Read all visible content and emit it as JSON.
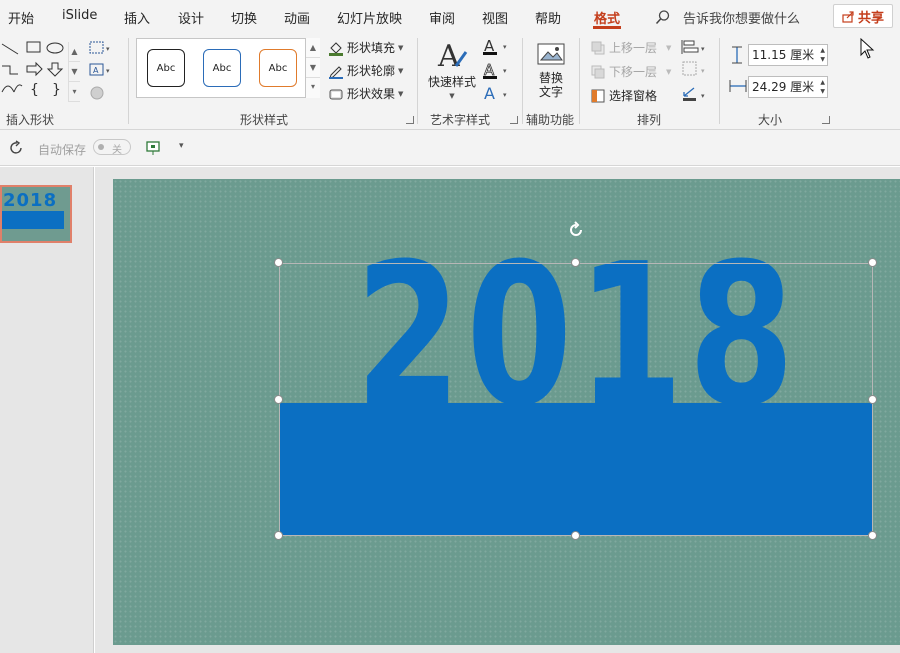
{
  "tabs": [
    "开始",
    "iSlide",
    "插入",
    "设计",
    "切换",
    "动画",
    "幻灯片放映",
    "审阅",
    "视图",
    "帮助",
    "格式"
  ],
  "active_tab": "格式",
  "search_hint": "告诉我你想要做什么",
  "share_label": "共享",
  "ribbon": {
    "insert_shapes_label": "插入形状",
    "shape_styles": {
      "gallery": [
        "Abc",
        "Abc",
        "Abc"
      ],
      "fill": "形状填充",
      "outline": "形状轮廓",
      "effects": "形状效果",
      "label": "形状样式"
    },
    "wordart": {
      "quick_styles": "快速样式",
      "label": "艺术字样式"
    },
    "accessibility": {
      "alt_text_line1": "替换",
      "alt_text_line2": "文字",
      "label": "辅助功能"
    },
    "arrange": {
      "bring_forward": "上移一层",
      "send_backward": "下移一层",
      "selection_pane": "选择窗格",
      "label": "排列"
    },
    "size": {
      "height": "11.15 厘米",
      "width": "24.29 厘米",
      "label": "大小"
    }
  },
  "qat": {
    "autosave_label": "自动保存",
    "autosave_state": "关"
  },
  "slide": {
    "year_text": "2018",
    "thumb_text": "2018"
  },
  "colors": {
    "accent": "#c43e1c",
    "slide_bg": "#6b9b8f",
    "shape_blue": "#0b6fc2"
  }
}
